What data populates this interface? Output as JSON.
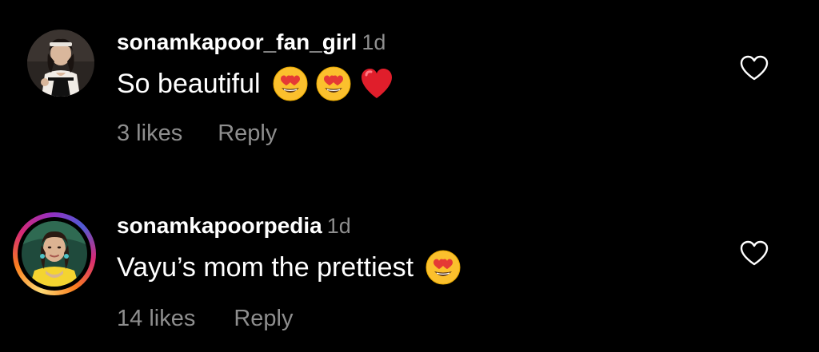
{
  "colors": {
    "background": "#000000",
    "primary_text": "#ffffff",
    "secondary_text": "#8e8e8e",
    "story_ring": [
      "#feda75",
      "#fa7e1e",
      "#d62976",
      "#962fbf",
      "#4f5bd5"
    ]
  },
  "comments": [
    {
      "username": "sonamkapoor_fan_girl",
      "time": "1d",
      "text": "So beautiful",
      "emojis": [
        "heart-eyes-emoji",
        "heart-eyes-emoji",
        "red-heart-emoji"
      ],
      "likes": "3 likes",
      "reply": "Reply",
      "has_story_ring": false,
      "like_icon": "heart-outline-icon"
    },
    {
      "username": "sonamkapoorpedia",
      "time": "1d",
      "text": "Vayu’s mom the prettiest",
      "emojis": [
        "heart-eyes-emoji"
      ],
      "likes": "14 likes",
      "reply": "Reply",
      "has_story_ring": true,
      "like_icon": "heart-outline-icon"
    }
  ]
}
